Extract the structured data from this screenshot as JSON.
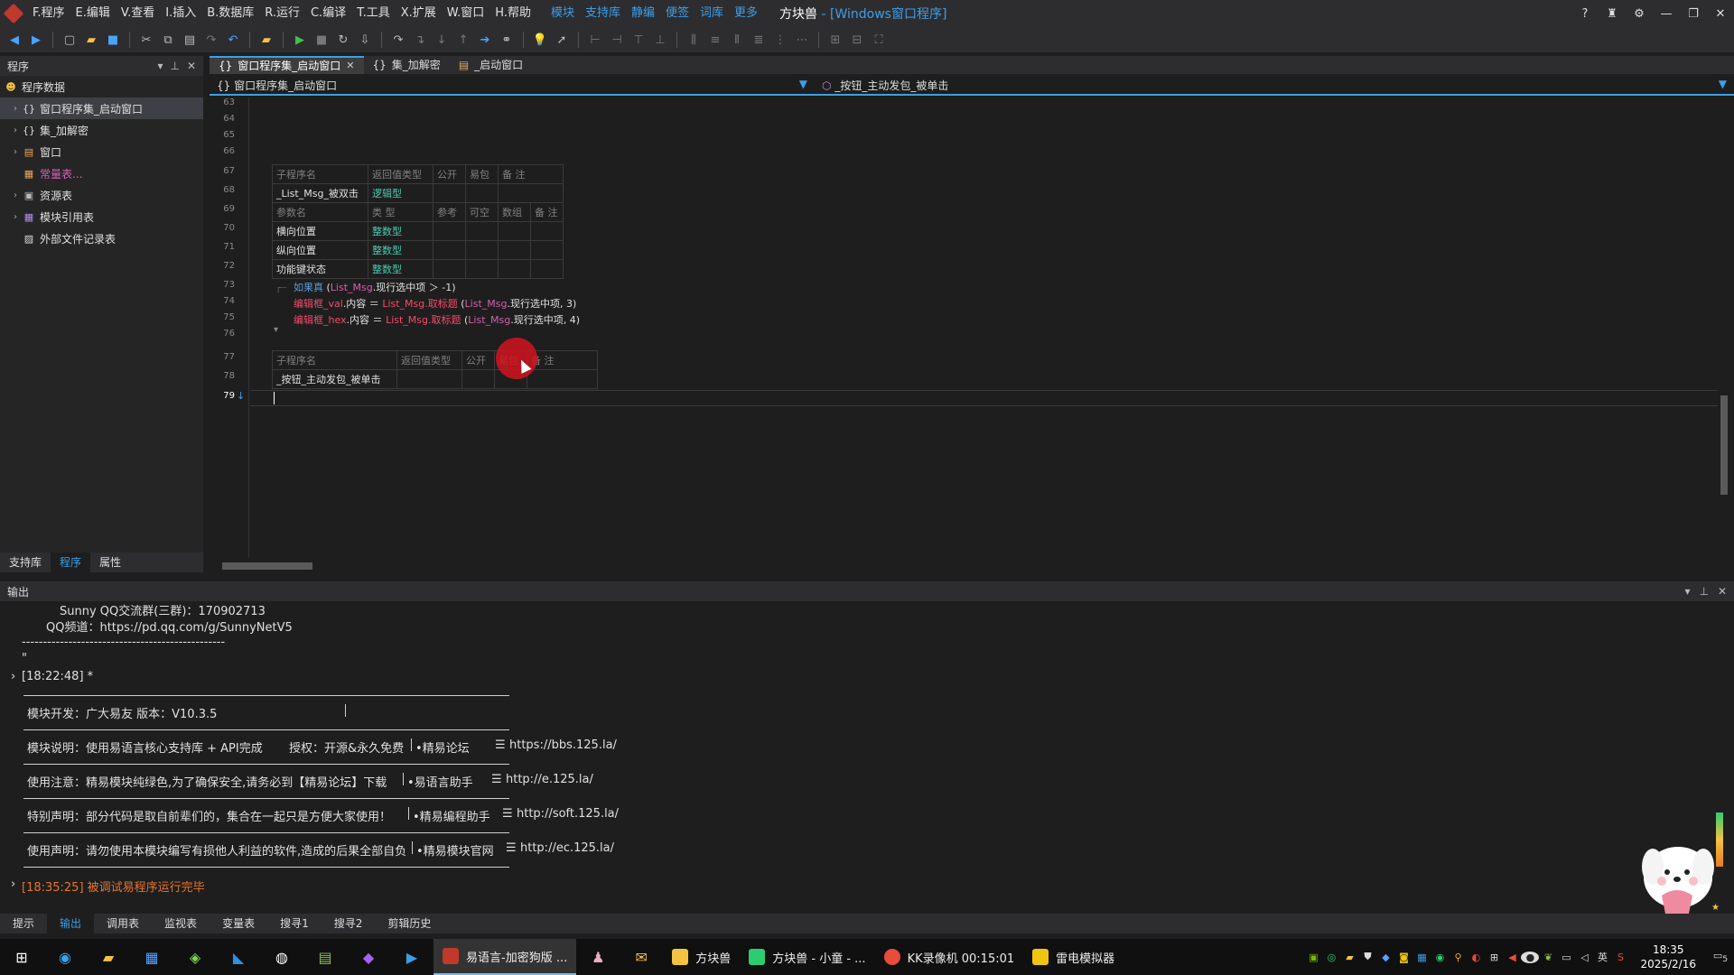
{
  "menu": {
    "items": [
      "F.程序",
      "E.编辑",
      "V.查看",
      "I.插入",
      "B.数据库",
      "R.运行",
      "C.编译",
      "T.工具",
      "X.扩展",
      "W.窗口",
      "H.帮助"
    ],
    "ext_items": [
      "模块",
      "支持库",
      "静编",
      "便签",
      "词库",
      "更多"
    ],
    "title": "方块兽",
    "title_sub": "- [Windows窗口程序]"
  },
  "left_panel": {
    "title": "程序",
    "root": "程序数据",
    "items": [
      {
        "label": "窗口程序集_启动窗口",
        "selected": true
      },
      {
        "label": "集_加解密"
      },
      {
        "label": "窗口"
      },
      {
        "label": "常量表..."
      },
      {
        "label": "资源表"
      },
      {
        "label": "模块引用表"
      },
      {
        "label": "外部文件记录表"
      }
    ],
    "tabs": [
      "支持库",
      "程序",
      "属性"
    ]
  },
  "editor": {
    "tabs": [
      {
        "label": "窗口程序集_启动窗口",
        "active": true
      },
      {
        "label": "集_加解密"
      },
      {
        "label": "_启动窗口"
      }
    ],
    "nav_left": "窗口程序集_启动窗口",
    "nav_right": "_按钮_主动发包_被单击",
    "line_numbers": [
      "63",
      "64",
      "65",
      "66",
      "67",
      "68",
      "69",
      "70",
      "71",
      "72",
      "73",
      "74",
      "75",
      "76",
      "77",
      "78",
      "79"
    ],
    "table1": {
      "header": [
        "子程序名",
        "返回值类型",
        "公开",
        "易包",
        "备 注"
      ],
      "row": [
        "_List_Msg_被双击",
        "逻辑型"
      ],
      "param_header": [
        "参数名",
        "类 型",
        "参考",
        "可空",
        "数组",
        "备 注"
      ],
      "params": [
        {
          "name": "横向位置",
          "type": "整数型"
        },
        {
          "name": "纵向位置",
          "type": "整数型"
        },
        {
          "name": "功能键状态",
          "type": "整数型"
        }
      ]
    },
    "code": {
      "l73_kw": "如果真",
      "l73_rest_a": "(",
      "l73_obj": "List_Msg",
      "l73_rest_b": ".现行选中项 ＞ -1)",
      "l74_var": "编辑框_val",
      "l74_prop": ".内容 ＝ ",
      "l74_obj": "List_Msg",
      "l74_fn": ".取标题",
      "l74_open": " (",
      "l74_obj2": "List_Msg",
      "l74_tail": ".现行选中项, 3)",
      "l75_var": "编辑框_hex",
      "l75_prop": ".内容 ＝ ",
      "l75_obj": "List_Msg",
      "l75_fn": ".取标题",
      "l75_open": " (",
      "l75_obj2": "List_Msg",
      "l75_tail": ".现行选中项, 4)"
    },
    "table2": {
      "header": [
        "子程序名",
        "返回值类型",
        "公开",
        "易包",
        "备 注"
      ],
      "row": [
        "_按钮_主动发包_被单击"
      ]
    }
  },
  "output": {
    "title": "输出",
    "lines": {
      "qq_group": "Sunny QQ交流群(三群)：170902713",
      "qq_channel": "QQ频道：https://pd.qq.com/g/SunnyNetV5",
      "divider": "------------------------------------------------",
      "tick": "\"",
      "timestamp1": "[18:22:48] *",
      "dev": "模块开发：广大易友    版本：V10.3.5",
      "desc": "模块说明：使用易语言核心支持库 + API完成",
      "auth": "授权：开源&永久免费",
      "forum": "•精易论坛",
      "forum_url": "https://bbs.125.la/",
      "notice": "使用注意：精易模块纯绿色,为了确保安全,请务必到【精易论坛】下载",
      "helper": "•易语言助手",
      "helper_url": "http://e.125.la/",
      "special": "特别声明：部分代码是取自前辈们的，集合在一起只是方便大家使用！",
      "prog_helper": "•精易编程助手",
      "prog_url": "http://soft.125.la/",
      "usage": "使用声明：请勿使用本模块编写有损他人利益的软件,造成的后果全部自负",
      "site": "•精易模块官网",
      "site_url": "http://ec.125.la/",
      "timestamp2": "[18:35:25] 被调试易程序运行完毕"
    },
    "tabs": [
      "提示",
      "输出",
      "调用表",
      "监视表",
      "变量表",
      "搜寻1",
      "搜寻2",
      "剪辑历史"
    ]
  },
  "taskbar": {
    "apps": [
      {
        "label": "易语言-加密狗版 ...",
        "active": true,
        "color": "#c0392b"
      },
      {
        "label": "方块兽",
        "color": "#f5c342"
      },
      {
        "label": "方块兽 - 小童 - ...",
        "color": "#2ecc71"
      },
      {
        "label": "KK录像机 00:15:01",
        "color": "#e74c3c"
      },
      {
        "label": "雷电模拟器",
        "color": "#f1c40f"
      }
    ],
    "time": "18:35",
    "date": "2025/2/16",
    "ime": "英",
    "notif": "5"
  }
}
